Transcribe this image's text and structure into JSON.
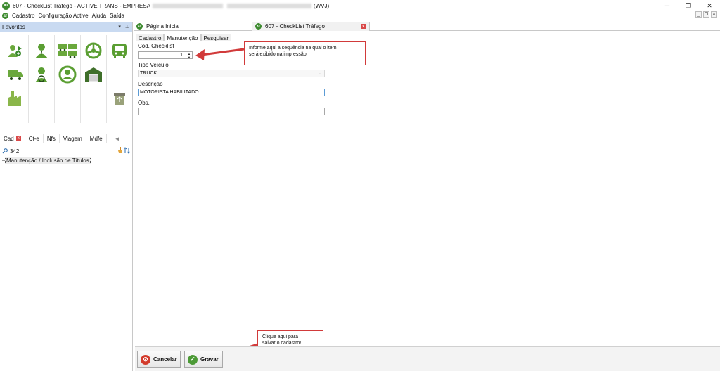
{
  "window": {
    "title_left": "607 - CheckList Tráfego - ACTIVE TRANS - EMPRESA",
    "title_right": "(WVJ)",
    "logo_text": "AT",
    "minimize_icon": "─",
    "restore_icon": "❐",
    "close_icon": "✕"
  },
  "menubar": {
    "items": [
      "Cadastro",
      "Configuração Active",
      "Ajuda",
      "Saída"
    ],
    "mdi": [
      "_",
      "❐",
      "✕"
    ]
  },
  "favorites": {
    "header": "Favoritos",
    "accent": "#3c8a2e",
    "icons": [
      "user-add-icon",
      "person-icon",
      "fleet-icon",
      "steering-wheel-icon",
      "bus-icon",
      "truck-icon",
      "driver-icon",
      "driver-wheel-icon",
      "warehouse-icon",
      "factory-icon",
      "recycle-bin-icon"
    ]
  },
  "left_tabs": {
    "items": [
      "Cad",
      "Ct-e",
      "Nfs",
      "Viagem",
      "Mdfe"
    ],
    "scroll": "◄"
  },
  "search": {
    "value": "342"
  },
  "tree": {
    "item": "Manutenção / Inclusão de Títulos"
  },
  "doc_tabs": {
    "home": "Página Inicial",
    "current": "607 - CheckList Tráfego"
  },
  "sub_tabs": [
    "Cadastro",
    "Manutenção",
    "Pesquisar"
  ],
  "form": {
    "cod_label": "Cód. Checklist",
    "cod_value": "1",
    "tipo_label": "Tipo Veículo",
    "tipo_value": "TRUCK",
    "desc_label": "Descrição",
    "desc_value": "MOTORISTA HABILITADO",
    "obs_label": "Obs.",
    "obs_value": ""
  },
  "callouts": {
    "top_line1": "Informe aqui a sequência na qual o item",
    "top_line2": "será exibido na impressão",
    "bottom_line1": "Clique aqui para",
    "bottom_line2": "salvar o cadastro!"
  },
  "buttons": {
    "cancel": "Cancelar",
    "save": "Gravar"
  }
}
